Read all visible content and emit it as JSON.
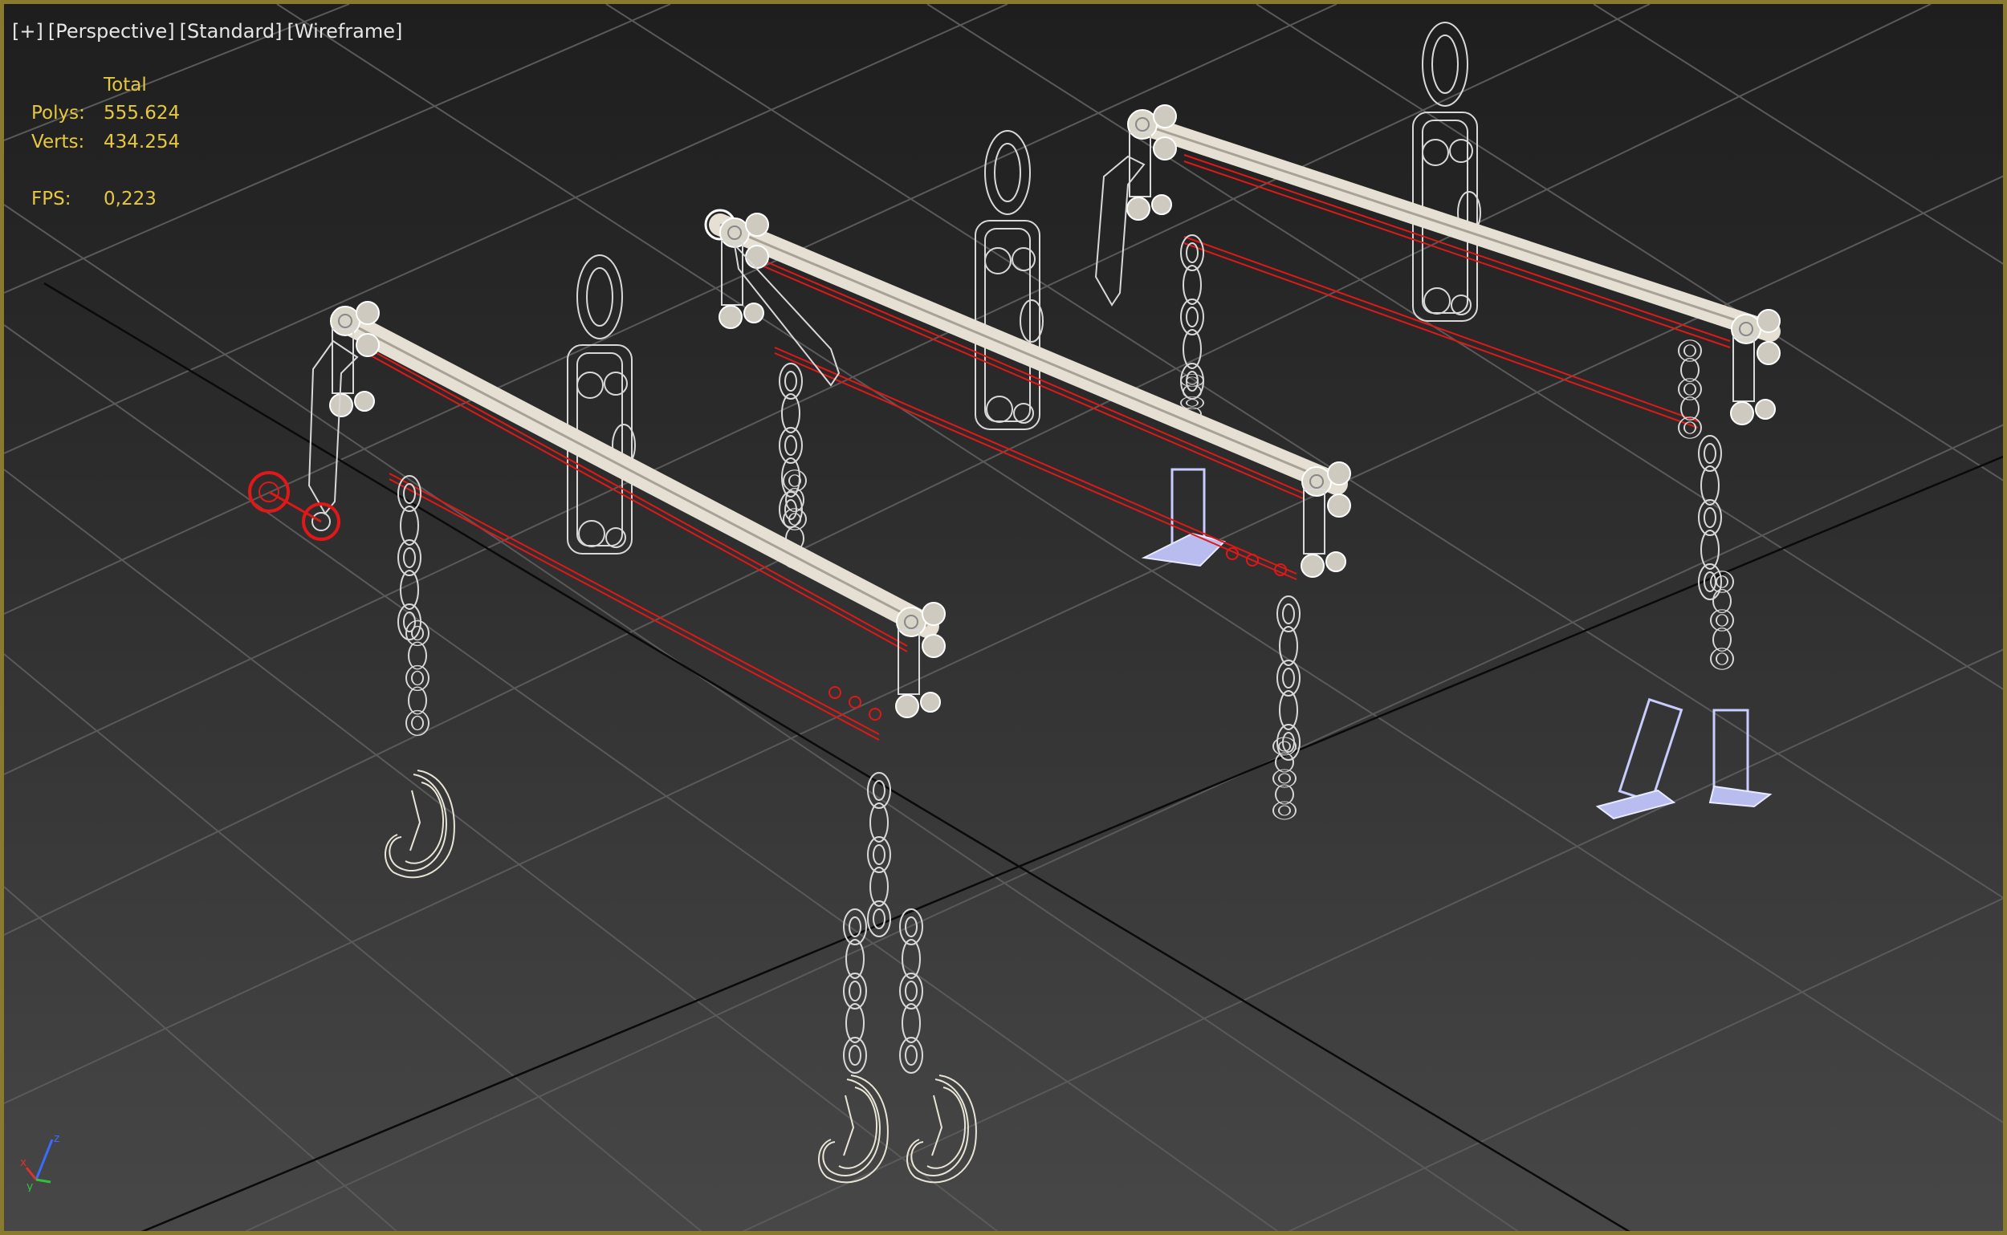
{
  "viewport": {
    "labels": [
      "[+]",
      "[Perspective]",
      "[Standard]",
      "[Wireframe]"
    ]
  },
  "stats": {
    "header": "Total",
    "rows": [
      {
        "key": "Polys:",
        "value": "555.624"
      },
      {
        "key": "Verts:",
        "value": "434.254"
      },
      {
        "key": "FPS:",
        "value": "0,223"
      }
    ]
  },
  "gizmo": {
    "x": "x",
    "y": "y",
    "z": "z"
  },
  "colors": {
    "frame_border": "#8a7a2e",
    "stat_text": "#e6c840",
    "wire_white": "#d8d8d8",
    "beam": "#cfcac0",
    "selected_red": "#e01818",
    "lavender": "#c8ccff"
  }
}
